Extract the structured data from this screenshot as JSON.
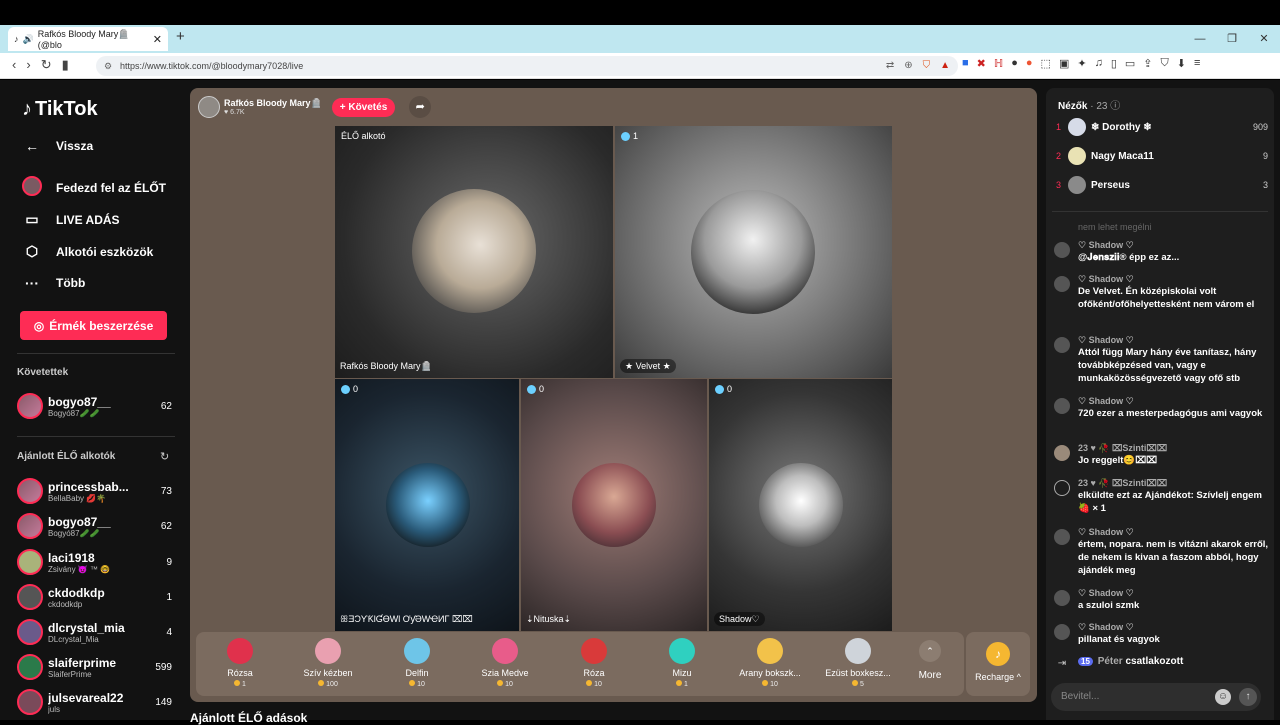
{
  "browser": {
    "tab_title": "Rafkós Bloody Mary🪦 (@blo",
    "url": "https://www.tiktok.com/@bloodymary7028/live"
  },
  "sidebar": {
    "logo": "TikTok",
    "nav": [
      {
        "label": "Vissza",
        "icon": "arrow-left-icon"
      },
      {
        "label": "Fedezd fel az ÉLŐT",
        "icon": "live-avatar-icon"
      },
      {
        "label": "LIVE ADÁS",
        "icon": "video-camera-icon"
      },
      {
        "label": "Alkotói eszközök",
        "icon": "creator-tools-icon"
      },
      {
        "label": "Több",
        "icon": "more-dots-icon"
      }
    ],
    "coins_button": "Érmék beszerzése",
    "following_title": "Követettek",
    "following": [
      {
        "name": "bogyo87__",
        "sub": "Bogyó87🥒🥒",
        "count": "62"
      }
    ],
    "recommended_title": "Ajánlott ÉLŐ alkotók",
    "recommended": [
      {
        "name": "princessbab...",
        "sub": "BellaBaby 💋🌴",
        "count": "73"
      },
      {
        "name": "bogyo87__",
        "sub": "Bogyó87🥒🥒",
        "count": "62"
      },
      {
        "name": "laci1918",
        "sub": "Zsivány 😈 ™ 🤓",
        "count": "9"
      },
      {
        "name": "ckdodkdp",
        "sub": "ckdodkdp",
        "count": "1"
      },
      {
        "name": "dlcrystal_mia",
        "sub": "DLcrystal_Mia",
        "count": "4"
      },
      {
        "name": "slaiferprime",
        "sub": "SlaiferPrime",
        "count": "599"
      },
      {
        "name": "julsevareal22",
        "sub": "juls",
        "count": "149"
      }
    ]
  },
  "stream": {
    "host_name": "Rafkós Bloody Mary🪦",
    "host_likes": "♥ 6.7K",
    "follow_button": "+ Követés",
    "cells": [
      {
        "top_label": "ÉLŐ alkotó",
        "bottom_label": "Rafkós Bloody Mary🪦"
      },
      {
        "top_label": "1",
        "bottom_label": "★ Velvet ★"
      },
      {
        "top_label": "0",
        "bottom_label": "ꕥƎƆƳƘƖƓƟWƖ ƠƴƏWҼИΓ ⌧⌧"
      },
      {
        "top_label": "0",
        "bottom_label": "⇣Nituska⇣"
      },
      {
        "top_label": "0",
        "bottom_label": "Shadow♡"
      }
    ],
    "gifts": [
      {
        "name": "Rózsa",
        "price": "1",
        "color": "#e0314c"
      },
      {
        "name": "Szív kézben",
        "price": "100",
        "color": "#e9a0b0"
      },
      {
        "name": "Delfin",
        "price": "10",
        "color": "#6ec5e8"
      },
      {
        "name": "Szia Medve",
        "price": "10",
        "color": "#e85c8a"
      },
      {
        "name": "Róza",
        "price": "10",
        "color": "#d93a3a"
      },
      {
        "name": "Mizu",
        "price": "1",
        "color": "#2fd0c0"
      },
      {
        "name": "Arany bokszk...",
        "price": "10",
        "color": "#f2c24a"
      },
      {
        "name": "Ezüst boxkesz...",
        "price": "5",
        "color": "#cfd4da"
      }
    ],
    "more_label": "More",
    "recharge_label": "Recharge ^"
  },
  "below_text": "Ajánlott ÉLŐ adások",
  "chat": {
    "viewers_title": "Nézők",
    "viewers_count": "· 23",
    "top_viewers": [
      {
        "rank": "1",
        "name": "❄ Dorothy ❄",
        "score": "909"
      },
      {
        "rank": "2",
        "name": "Nagy Maca11",
        "score": "9"
      },
      {
        "rank": "3",
        "name": "Perseus",
        "score": "3"
      }
    ],
    "faded_text": "nem lehet megélni",
    "messages": [
      {
        "user": "♡ Shadow ♡",
        "text": "@𝐉𝐞𝐧𝐬𝐳𝐢𝐢® épp ez az..."
      },
      {
        "user": "♡ Shadow ♡",
        "text": "De Velvet. Én középiskolai volt ofőként/ofőhelyettesként nem várom el"
      },
      {
        "user": "♡ Shadow ♡",
        "text": "Attól függ Mary hány éve tanítasz, hány továbbképzésed van, vagy e munkaközösségvezető vagy ofő stb"
      },
      {
        "user": "♡ Shadow ♡",
        "text": "720 ezer a mesterpedagógus ami vagyok"
      },
      {
        "user": "23 ♥ 🥀 ⌧Szinti⌧⌧",
        "text": "Jo reggelt😊⌧⌧"
      },
      {
        "user": "23 ♥ 🥀 ⌧Szinti⌧⌧",
        "text": "elküldte ezt az Ajándékot: Szívlelj engem 🍓 × 1"
      },
      {
        "user": "♡ Shadow ♡",
        "text": "értem, nopara. nem is vitázni akarok erről, de nekem is kivan a faszom abból, hogy ajándék meg"
      },
      {
        "user": "♡ Shadow ♡",
        "text": "a szuloi szmk"
      },
      {
        "user": "♡ Shadow ♡",
        "text": "pillanat és vagyok"
      }
    ],
    "join_badge": "15",
    "join_name": "Péter",
    "join_text": "csatlakozott",
    "input_placeholder": "Bevitel..."
  }
}
